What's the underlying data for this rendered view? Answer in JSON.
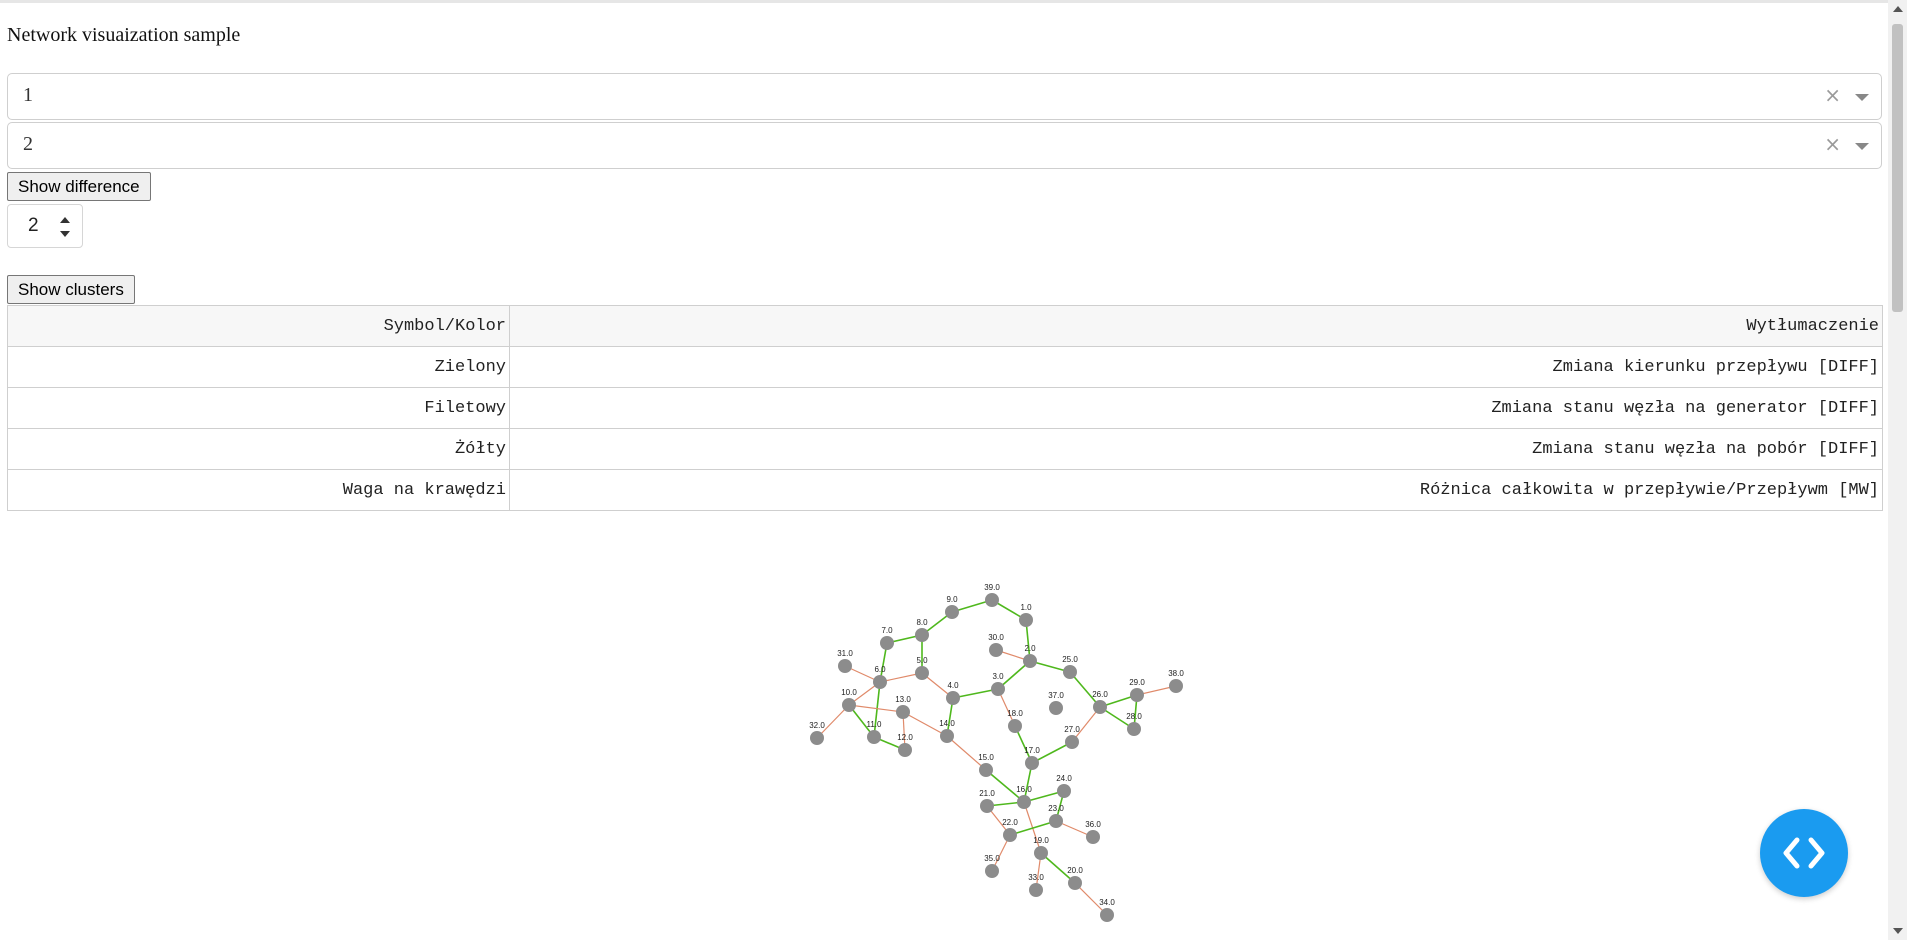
{
  "page": {
    "title": "Network visuaization sample"
  },
  "dropdowns": [
    {
      "value": "1",
      "clear_glyph": "×"
    },
    {
      "value": "2",
      "clear_glyph": "×"
    }
  ],
  "buttons": {
    "show_difference": "Show difference",
    "show_clusters": "Show clusters"
  },
  "stepper": {
    "value": "2"
  },
  "legend_table": {
    "headers": [
      "Symbol/Kolor",
      "Wytłumaczenie"
    ],
    "rows": [
      [
        "Zielony",
        "Zmiana kierunku przepływu [DIFF]"
      ],
      [
        "Filetowy",
        "Zmiana stanu węzła na generator [DIFF]"
      ],
      [
        "Żółty",
        "Zmiana stanu węzła na pobór [DIFF]"
      ],
      [
        "Waga na krawędzi",
        "Różnica całkowita w przepływie/Przepływm [MW]"
      ]
    ]
  },
  "graph": {
    "colors": {
      "node": "#8c8c8c",
      "edge_changed": "#4fb81d",
      "edge_default": "#e08a6a"
    },
    "nodes": [
      "1.0",
      "2.0",
      "3.0",
      "4.0",
      "5.0",
      "6.0",
      "7.0",
      "8.0",
      "9.0",
      "10.0",
      "11.0",
      "12.0",
      "13.0",
      "14.0",
      "15.0",
      "16.0",
      "17.0",
      "18.0",
      "19.0",
      "20.0",
      "21.0",
      "22.0",
      "23.0",
      "24.0",
      "25.0",
      "26.0",
      "27.0",
      "28.0",
      "29.0",
      "30.0",
      "31.0",
      "32.0",
      "33.0",
      "34.0",
      "35.0",
      "36.0",
      "37.0",
      "38.0",
      "39.0"
    ]
  },
  "icons": {
    "fab": "code-icon"
  }
}
